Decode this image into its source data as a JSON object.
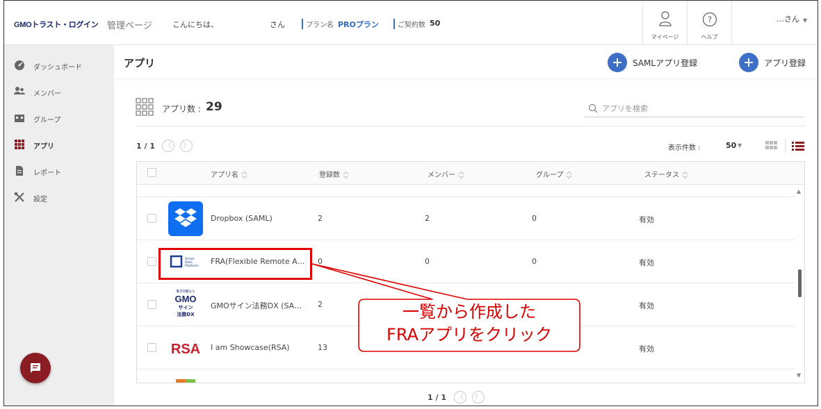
{
  "header": {
    "logo": "GMOトラスト・ログイン",
    "mgmt_label": "管理ページ",
    "greeting": "こんにちは、",
    "honorific": "さん",
    "plan_label": "プラン名",
    "plan_value": "PROプラン",
    "contract_label": "ご契約数",
    "contract_value": "50",
    "mypage_label": "マイページ",
    "help_label": "ヘルプ",
    "user_name": "…さん"
  },
  "sidebar": {
    "items": [
      {
        "label": "ダッシュボード",
        "icon": "dashboard-icon"
      },
      {
        "label": "メンバー",
        "icon": "members-icon"
      },
      {
        "label": "グループ",
        "icon": "group-icon"
      },
      {
        "label": "アプリ",
        "icon": "apps-grid-icon",
        "active": true
      },
      {
        "label": "レポート",
        "icon": "report-icon"
      },
      {
        "label": "設定",
        "icon": "settings-icon"
      }
    ]
  },
  "main": {
    "title": "アプリ",
    "saml_register": "SAMLアプリ登録",
    "app_register": "アプリ登録",
    "count_label": "アプリ数 :",
    "count_value": "29",
    "search_placeholder": "アプリを検索",
    "pagination": "1 / 1",
    "per_page_label": "表示件数 :",
    "per_page_value": "50"
  },
  "table": {
    "columns": [
      "アプリ名",
      "登録数",
      "メンバー",
      "グループ",
      "ステータス"
    ],
    "rows": [
      {
        "name": "Dropbox (SAML)",
        "registered": "2",
        "members": "2",
        "groups": "0",
        "status": "有効",
        "logo": "dropbox-logo"
      },
      {
        "name": "FRA(Flexible Remote Acce...",
        "registered": "0",
        "members": "0",
        "groups": "0",
        "status": "有効",
        "logo": "smart-data-platform-logo"
      },
      {
        "name": "GMOサイン法務DX (SAML)",
        "registered": "2",
        "members": "",
        "groups": "",
        "status": "有効",
        "logo": "gmo-sign-logo"
      },
      {
        "name": "I am Showcase(RSA)",
        "registered": "13",
        "members": "",
        "groups": "",
        "status": "有効",
        "logo": "rsa-logo"
      }
    ],
    "logo_texts": {
      "sdp": [
        "Smart",
        "Data",
        "Platform"
      ],
      "gmo_top": "電子印鑑なら",
      "gmo_mid": "GMO",
      "gmo_sign": "サイン",
      "gmo_dx": "法務DX",
      "rsa": "RSA"
    }
  },
  "annotation": {
    "line1": "一覧から作成した",
    "line2": "FRAアプリをクリック"
  },
  "colors": {
    "accent": "#3d6fc6",
    "annotation": "#e00000",
    "chat": "#8a1c24",
    "sidebar_bg": "#eeeeee"
  }
}
